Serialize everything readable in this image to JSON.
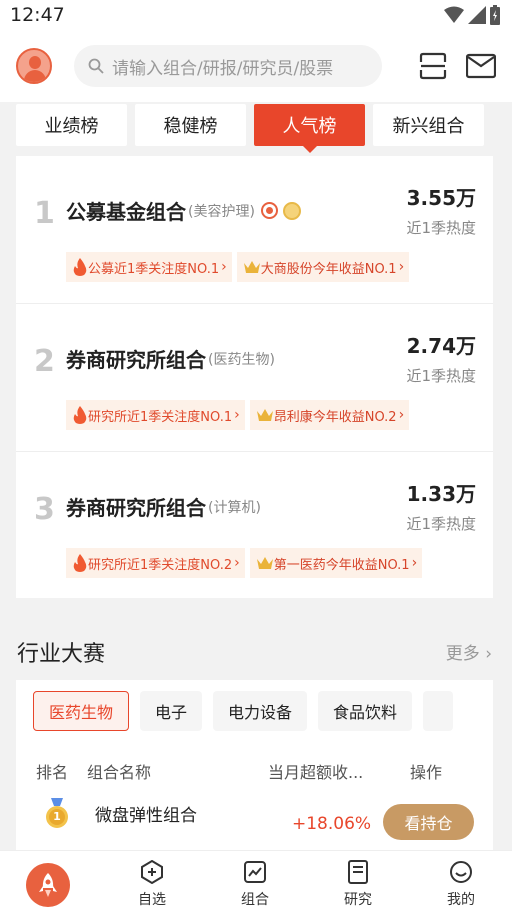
{
  "status": {
    "time": "12:47"
  },
  "search": {
    "placeholder": "请输入组合/研报/研究员/股票"
  },
  "tabs": [
    {
      "label": "业绩榜"
    },
    {
      "label": "稳健榜"
    },
    {
      "label": "人气榜"
    },
    {
      "label": "新兴组合"
    }
  ],
  "active_tab": "人气榜",
  "ranking": [
    {
      "rank": "1",
      "name": "公募基金组合",
      "tag": "(美容护理)",
      "value": "3.55万",
      "sub": "近1季热度",
      "badges": [
        "公募近1季关注度NO.1",
        "大商股份今年收益NO.1"
      ]
    },
    {
      "rank": "2",
      "name": "券商研究所组合",
      "tag": "(医药生物)",
      "value": "2.74万",
      "sub": "近1季热度",
      "badges": [
        "研究所近1季关注度NO.1",
        "昂利康今年收益NO.2"
      ]
    },
    {
      "rank": "3",
      "name": "券商研究所组合",
      "tag": "(计算机)",
      "value": "1.33万",
      "sub": "近1季热度",
      "badges": [
        "研究所近1季关注度NO.2",
        "第一医药今年收益NO.1"
      ]
    }
  ],
  "industry": {
    "title": "行业大赛",
    "more": "更多",
    "tabs": [
      "医药生物",
      "电子",
      "电力设备",
      "食品饮料"
    ],
    "headers": {
      "rank": "排名",
      "name": "组合名称",
      "return": "当月超额收...",
      "action": "操作"
    },
    "rows": [
      {
        "medal": "1",
        "name": "微盘弹性组合",
        "return": "+18.06%",
        "button": "看持仓"
      }
    ]
  },
  "nav": {
    "items": [
      "自选",
      "组合",
      "研究",
      "我的"
    ]
  },
  "colors": {
    "accent": "#e8462b",
    "gold_button": "#c89a64",
    "badge_bg": "#fdf1e8"
  }
}
